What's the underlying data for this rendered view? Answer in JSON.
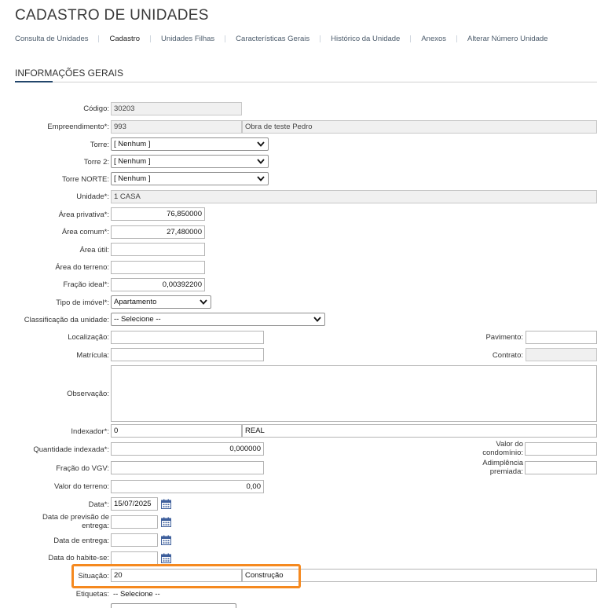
{
  "page": {
    "title": "CADASTRO DE UNIDADES"
  },
  "tabs": [
    {
      "label": "Consulta de Unidades"
    },
    {
      "label": "Cadastro"
    },
    {
      "label": "Unidades Filhas"
    },
    {
      "label": "Características Gerais"
    },
    {
      "label": "Histórico da Unidade"
    },
    {
      "label": "Anexos"
    },
    {
      "label": "Alterar Número Unidade"
    }
  ],
  "active_tab": "Cadastro",
  "section": {
    "title": "INFORMAÇÕES GERAIS"
  },
  "colors": {
    "highlight": "#f5891f",
    "accent": "#23466b",
    "calendar_icon": "#3e5f9c"
  },
  "form": {
    "codigo": {
      "label": "Código:",
      "value": "30203"
    },
    "empreendimento": {
      "label": "Empreendimento*:",
      "code": "993",
      "name": "Obra de teste Pedro"
    },
    "torre": {
      "label": "Torre:",
      "value": "[ Nenhum ]"
    },
    "torre2": {
      "label": "Torre 2:",
      "value": "[ Nenhum ]"
    },
    "torre_norte": {
      "label": "Torre NORTE:",
      "value": "[ Nenhum ]"
    },
    "unidade": {
      "label": "Unidade*:",
      "value": "1 CASA"
    },
    "area_privativa": {
      "label": "Área privativa*:",
      "value": "76,850000"
    },
    "area_comum": {
      "label": "Área comum*:",
      "value": "27,480000"
    },
    "area_util": {
      "label": "Área útil:",
      "value": ""
    },
    "area_terreno": {
      "label": "Área do terreno:",
      "value": ""
    },
    "fracao_ideal": {
      "label": "Fração ideal*:",
      "value": "0,00392200"
    },
    "tipo_imovel": {
      "label": "Tipo de imóvel*:",
      "value": "Apartamento"
    },
    "classificacao": {
      "label": "Classificação da unidade:",
      "value": "-- Selecione --"
    },
    "localizacao": {
      "label": "Localização:",
      "value": ""
    },
    "pavimento": {
      "label": "Pavimento:",
      "value": ""
    },
    "matricula": {
      "label": "Matrícula:",
      "value": ""
    },
    "contrato": {
      "label": "Contrato:",
      "value": ""
    },
    "observacao": {
      "label": "Observação:",
      "value": ""
    },
    "indexador": {
      "label": "Indexador*:",
      "code": "0",
      "name": "REAL"
    },
    "quantidade_indexada": {
      "label": "Quantidade indexada*:",
      "value": "0,000000"
    },
    "valor_condominio": {
      "label_line1": "Valor do",
      "label_line2": "condomínio:",
      "value": ""
    },
    "fracao_vgv": {
      "label": "Fração do VGV:",
      "value": ""
    },
    "adimplencia": {
      "label_line1": "Adimplência",
      "label_line2": "premiada:",
      "value": ""
    },
    "valor_terreno": {
      "label": "Valor do terreno:",
      "value": "0,00"
    },
    "data": {
      "label": "Data*:",
      "value": "15/07/2025"
    },
    "data_previsao": {
      "label_line1": "Data de previsão de",
      "label_line2": "entrega:",
      "value": ""
    },
    "data_entrega": {
      "label": "Data de entrega:",
      "value": ""
    },
    "data_habite": {
      "label": "Data do habite-se:",
      "value": ""
    },
    "situacao": {
      "label": "Situação:",
      "code": "20",
      "name": "Construção"
    },
    "etiquetas": {
      "label": "Etiquetas:",
      "value": "-- Selecione --"
    }
  }
}
